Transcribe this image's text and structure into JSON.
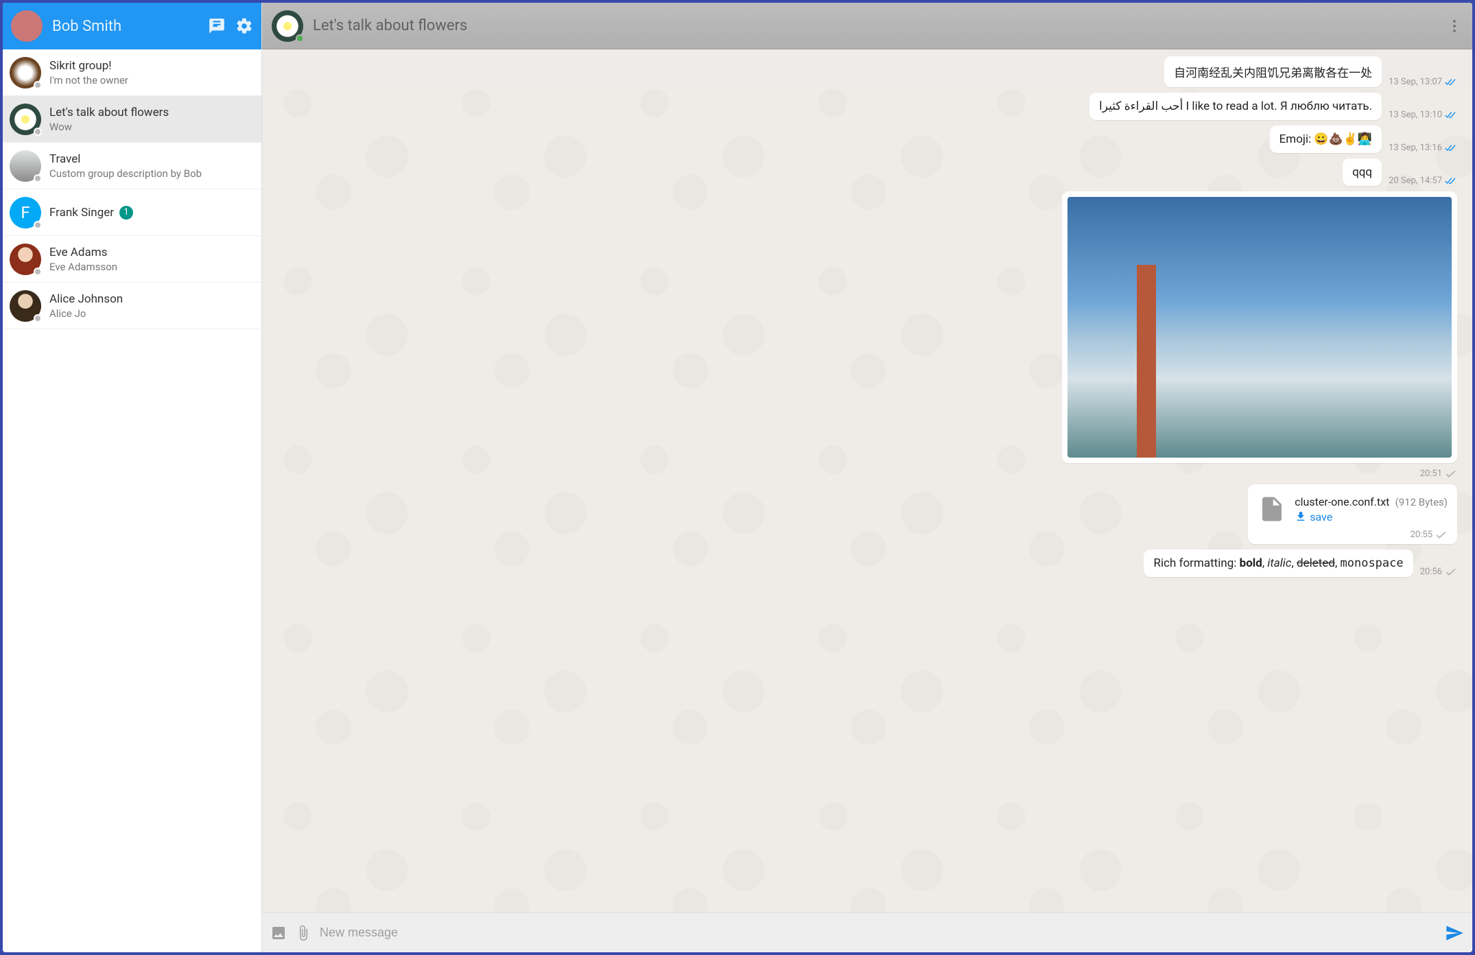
{
  "sidebar": {
    "user_name": "Bob Smith",
    "chats": [
      {
        "title": "Sikrit group!",
        "sub": "I'm not the owner",
        "avatar": "av-cup",
        "selected": false,
        "badge": null
      },
      {
        "title": "Let's talk about flowers",
        "sub": "Wow",
        "avatar": "av-flower",
        "selected": true,
        "badge": null
      },
      {
        "title": "Travel",
        "sub": "Custom group description by Bob",
        "avatar": "av-travel",
        "selected": false,
        "badge": null
      },
      {
        "title": "Frank Singer",
        "sub": "",
        "avatar": "av-letter",
        "letter": "F",
        "selected": false,
        "badge": "1"
      },
      {
        "title": "Eve Adams",
        "sub": "Eve Adamsson",
        "avatar": "av-eve",
        "selected": false,
        "badge": null
      },
      {
        "title": "Alice Johnson",
        "sub": "Alice Jo",
        "avatar": "av-alice",
        "selected": false,
        "badge": null
      }
    ]
  },
  "conversation": {
    "title": "Let's talk about flowers",
    "messages": [
      {
        "kind": "text",
        "text": "自河南经乱关内阻饥兄弟离散各在一处",
        "time": "13 Sep, 13:07",
        "read": true
      },
      {
        "kind": "text",
        "text": "أحب القراءة كثيرا I like to read a lot. Я люблю читать.",
        "time": "13 Sep, 13:10",
        "read": true
      },
      {
        "kind": "text",
        "text": "Emoji: 😀💩✌️👩‍💻",
        "time": "13 Sep, 13:16",
        "read": true
      },
      {
        "kind": "text",
        "text": "qqq",
        "time": "20 Sep, 14:57",
        "read": true
      },
      {
        "kind": "image",
        "time": "20:51",
        "read": false
      },
      {
        "kind": "file",
        "filename": "cluster-one.conf.txt",
        "filesize": "(912 Bytes)",
        "save_label": "save",
        "time": "20:55",
        "read": false
      },
      {
        "kind": "rich",
        "prefix": "Rich formatting: ",
        "bold": "bold",
        "italic": "italic",
        "deleted": "deleted",
        "mono": "monospace",
        "time": "20:56",
        "read": false
      }
    ]
  },
  "composer": {
    "placeholder": "New message"
  }
}
